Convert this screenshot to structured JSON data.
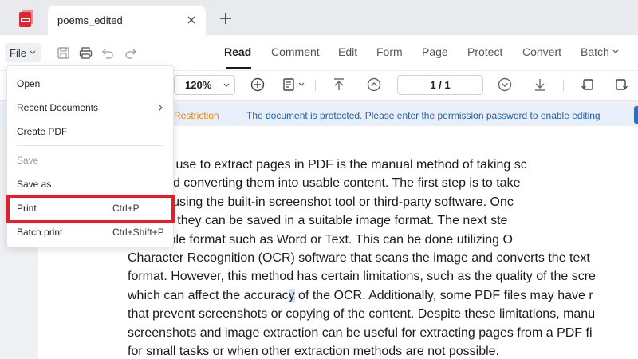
{
  "tab": {
    "title": "poems_edited"
  },
  "toolbar": {
    "file_label": "File",
    "nav_tabs": [
      "Read",
      "Comment",
      "Edit",
      "Form",
      "Page",
      "Protect",
      "Convert",
      "Batch"
    ]
  },
  "subtoolbar": {
    "zoom": "120%",
    "page_indicator": "1 / 1"
  },
  "notice": {
    "restriction": "Restriction",
    "message": "The document is protected. Please enter the permission password to enable editing"
  },
  "menu": {
    "items": [
      {
        "label": "Open",
        "shortcut": ""
      },
      {
        "label": "Recent Documents",
        "shortcut": ""
      },
      {
        "label": "Create PDF",
        "shortcut": ""
      },
      {
        "label": "Save",
        "shortcut": ""
      },
      {
        "label": "Save as",
        "shortcut": ""
      },
      {
        "label": "Print",
        "shortcut": "Ctrl+P"
      },
      {
        "label": "Batch print",
        "shortcut": "Ctrl+Shift+P"
      }
    ]
  },
  "document": {
    "lines": [
      "option you can use to extract pages in PDF is the manual method of taking sc",
      "sired pages and converting them into usable content. The first step is to take",
      "elected pages using the built-in screenshot tool or third-party software. Onc",
      "hots are taken, they can be saved in a suitable image format. The next ste",
      "ges into a usable format such as Word or Text. This can be done utilizing O",
      "Character Recognition (OCR) software that scans the image and converts the text",
      "format. However, this method has certain limitations, such as the quality of the scre",
      "which can affect the accurac",
      "y",
      " of the OCR. Additionally, some PDF files may have r",
      "that prevent screenshots or copying of the content. Despite these limitations, manu",
      "screenshots and image extraction can be useful for extracting pages from a PDF fi",
      "for small tasks or when other extraction methods are not possible."
    ]
  },
  "colors": {
    "accent": "#1e6fe0",
    "highlight": "#e0202a",
    "warning": "#e2890a"
  }
}
